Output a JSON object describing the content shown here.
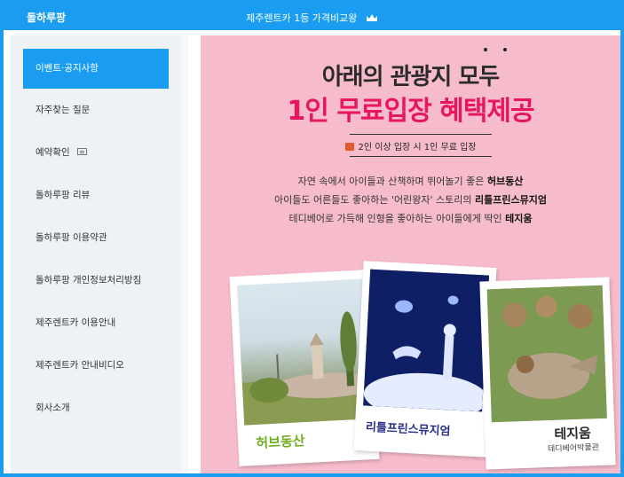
{
  "header": {
    "brand": "돌하루팡",
    "tagline": "제주렌트카 1등 가격비교왕"
  },
  "sidebar": {
    "items": [
      {
        "label": "이벤트·공지사항",
        "active": true
      },
      {
        "label": "자주찾는 질문",
        "active": false
      },
      {
        "label": "예약확인",
        "active": false,
        "icon": "document-icon"
      },
      {
        "label": "돌하루팡 리뷰",
        "active": false
      },
      {
        "label": "돌하루팡 이용약관",
        "active": false
      },
      {
        "label": "돌하루팡 개인정보처리방침",
        "active": false
      },
      {
        "label": "제주렌트카 이용안내",
        "active": false
      },
      {
        "label": "제주렌트카 안내비디오",
        "active": false
      },
      {
        "label": "회사소개",
        "active": false
      }
    ]
  },
  "promo": {
    "headline1": "아래의 관광지 모두",
    "headline2": "1인 무료입장 혜택제공",
    "badge": "2인 이상 입장 시 1인 무료 입장",
    "lines": [
      {
        "pre": "자연 속에서 아이들과 산책하며 뛰어놀기 좋은 ",
        "bold": "허브동산"
      },
      {
        "pre": "아이들도 어른들도 좋아하는 '어린왕자' 스토리의 ",
        "bold": "리틀프린스뮤지엄"
      },
      {
        "pre": "테디베어로 가득해 인형을 좋아하는 아이들에게 딱인 ",
        "bold": "테지움"
      }
    ],
    "photos": [
      {
        "label": "허브동산",
        "label_color": "#6fae23"
      },
      {
        "label": "리틀프린스뮤지엄",
        "label_color": "#2a2f8a"
      },
      {
        "label": "테지움",
        "sub": "테디베어박물관",
        "label_color": "#2b2b2b"
      }
    ]
  },
  "colors": {
    "accent": "#1a9df0",
    "promo_bg": "#f7bccb",
    "headline_red": "#e8155f"
  }
}
